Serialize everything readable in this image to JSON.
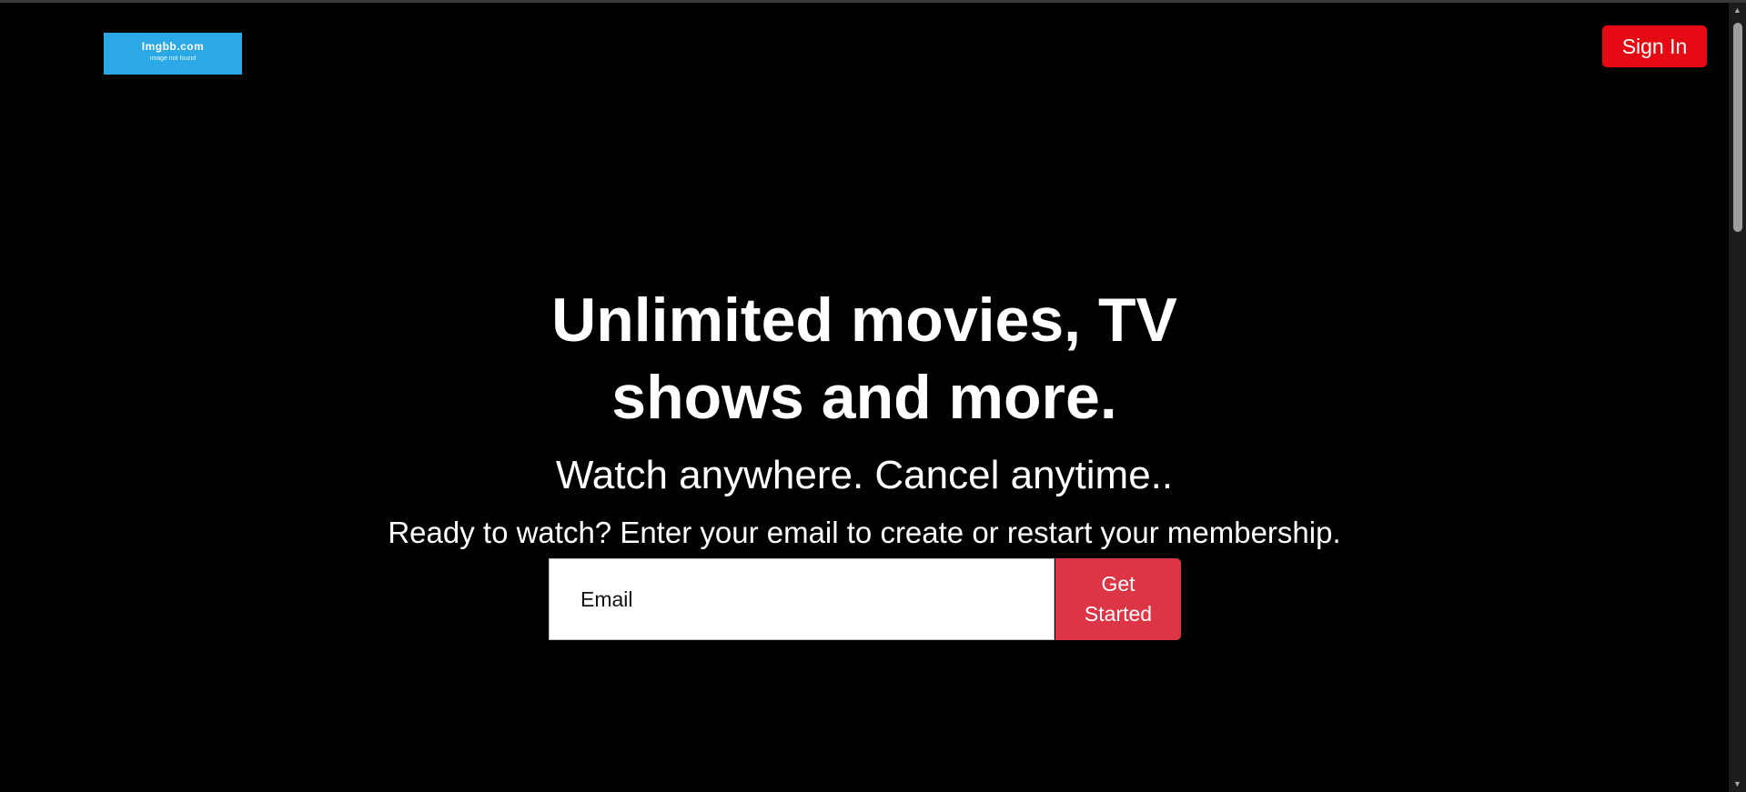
{
  "logo": {
    "title": "Imgbb.com",
    "subtitle": "image not found",
    "color": "#2aa9e6"
  },
  "header": {
    "signin_label": "Sign In",
    "signin_color": "#e50914"
  },
  "hero": {
    "headline": "Unlimited movies, TV shows and more.",
    "subheadline": "Watch anywhere. Cancel anytime..",
    "cta_text": "Ready to watch? Enter your email to create or restart your membership."
  },
  "form": {
    "email_placeholder": "Email",
    "email_value": "",
    "submit_label": "Get Started",
    "submit_color": "#dc3545"
  },
  "scrollbar": {
    "up_icon": "chevron-up-icon",
    "down_icon": "chevron-down-icon"
  }
}
